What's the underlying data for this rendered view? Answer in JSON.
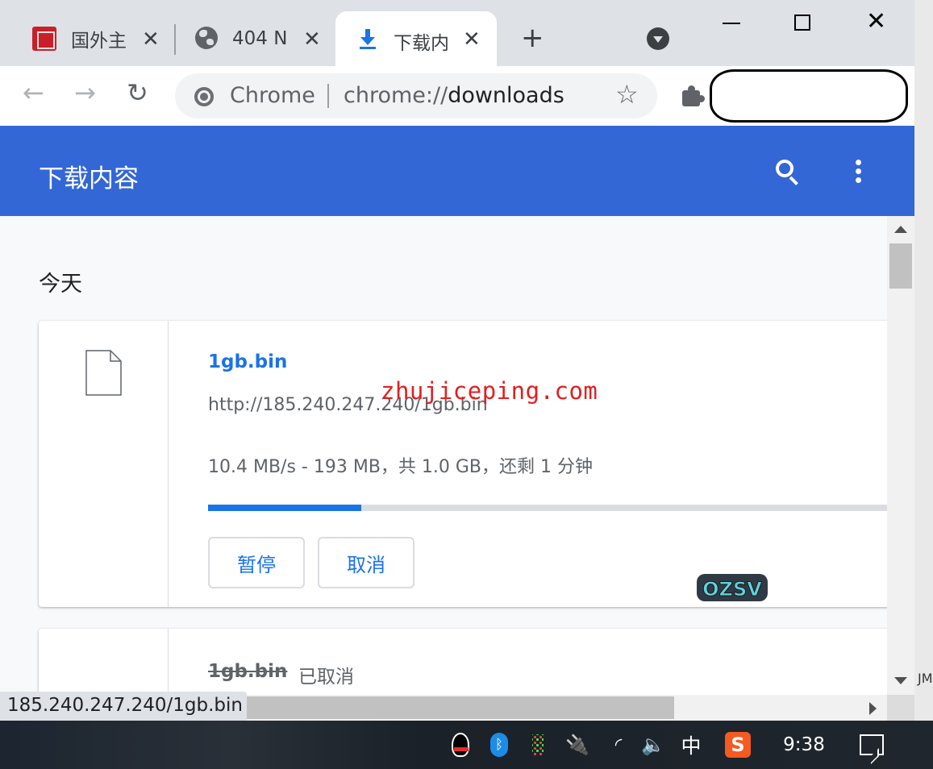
{
  "window": {
    "tabs": [
      {
        "title": "国外主",
        "favicon": "seal-icon",
        "close": "✕"
      },
      {
        "title": "404 N",
        "favicon": "globe-icon",
        "close": "✕"
      },
      {
        "title": "下载内",
        "favicon": "download-icon",
        "close": "✕",
        "active": true
      }
    ],
    "new_tab": "+",
    "controls": {
      "minimize": "",
      "maximize": "",
      "close": "✕"
    }
  },
  "toolbar": {
    "back": "←",
    "forward": "→",
    "reload": "↻",
    "omnibox": {
      "chip": "Chrome",
      "url_scheme": "chrome://",
      "url_host": "downloads"
    },
    "bookmark": "☆"
  },
  "page": {
    "title": "下载内容",
    "section": "今天",
    "downloads": [
      {
        "file": "1gb.bin",
        "url": "http://185.240.247.240/1gb.bin",
        "status": "10.4 MB/s - 193 MB，共 1.0 GB，还剩 1 分钟",
        "progress": 0.213,
        "buttons": {
          "pause": "暂停",
          "cancel": "取消"
        }
      },
      {
        "file": "1gb.bin",
        "state": "已取消"
      }
    ]
  },
  "watermark": "zhujiceping.com",
  "overlay_logo": "OZSV",
  "status_bubble": "185.240.247.240/1gb.bin",
  "right_edge_text": "JM",
  "taskbar": {
    "ime": "中",
    "sogou": "S",
    "clock": "9:38",
    "bluetooth": "ᛒ",
    "power": "🔌",
    "wifi": "◜",
    "volume": "🔈"
  },
  "colors": {
    "accent": "#1a73e8",
    "header": "#3367d6",
    "watermark": "#e02020"
  }
}
